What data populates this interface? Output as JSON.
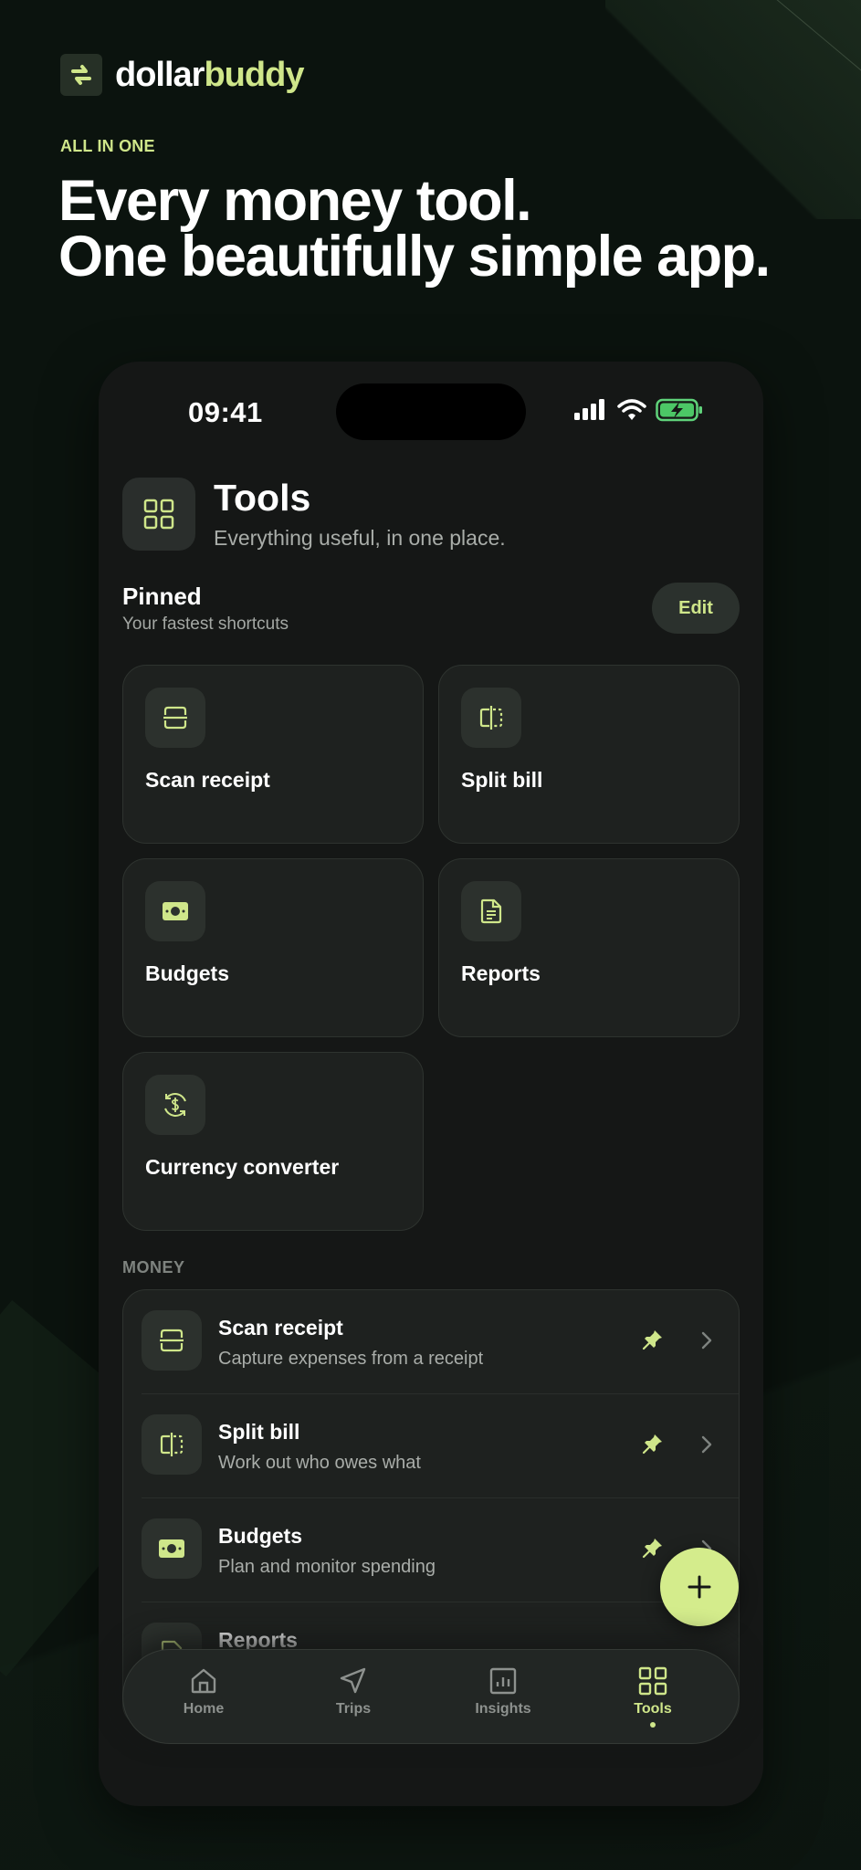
{
  "brand": {
    "name_part1": "dollar",
    "name_part2": "buddy",
    "logo_icon": "arrows-swap-icon"
  },
  "hero": {
    "eyebrow": "ALL IN ONE",
    "line1": "Every money tool.",
    "line2": "One beautifully simple app."
  },
  "status_bar": {
    "time": "09:41",
    "icons": [
      "signal-icon",
      "wifi-icon",
      "battery-charging-icon"
    ]
  },
  "page": {
    "title": "Tools",
    "subtitle": "Everything useful, in one place.",
    "icon": "grid-icon"
  },
  "pinned": {
    "title": "Pinned",
    "subtitle": "Your fastest shortcuts",
    "edit_label": "Edit",
    "cards": [
      {
        "label": "Scan receipt",
        "icon": "receipt-scan-icon"
      },
      {
        "label": "Split bill",
        "icon": "split-icon"
      },
      {
        "label": "Budgets",
        "icon": "banknote-icon"
      },
      {
        "label": "Reports",
        "icon": "document-icon"
      },
      {
        "label": "Currency converter",
        "icon": "currency-exchange-icon"
      }
    ]
  },
  "money": {
    "section_label": "MONEY",
    "items": [
      {
        "title": "Scan receipt",
        "subtitle": "Capture expenses from a receipt",
        "icon": "receipt-scan-icon"
      },
      {
        "title": "Split bill",
        "subtitle": "Work out who owes what",
        "icon": "split-icon"
      },
      {
        "title": "Budgets",
        "subtitle": "Plan and monitor spending",
        "icon": "banknote-icon"
      },
      {
        "title": "Reports",
        "subtitle": "",
        "icon": "document-icon"
      }
    ]
  },
  "tabbar": {
    "tabs": [
      {
        "label": "Home",
        "icon": "home-icon"
      },
      {
        "label": "Trips",
        "icon": "navigation-icon"
      },
      {
        "label": "Insights",
        "icon": "chart-icon"
      },
      {
        "label": "Tools",
        "icon": "grid-icon",
        "active": true
      }
    ]
  },
  "colors": {
    "accent": "#cfe68a",
    "background": "#0b130e",
    "phone": "#151716",
    "card": "#1e211f"
  }
}
